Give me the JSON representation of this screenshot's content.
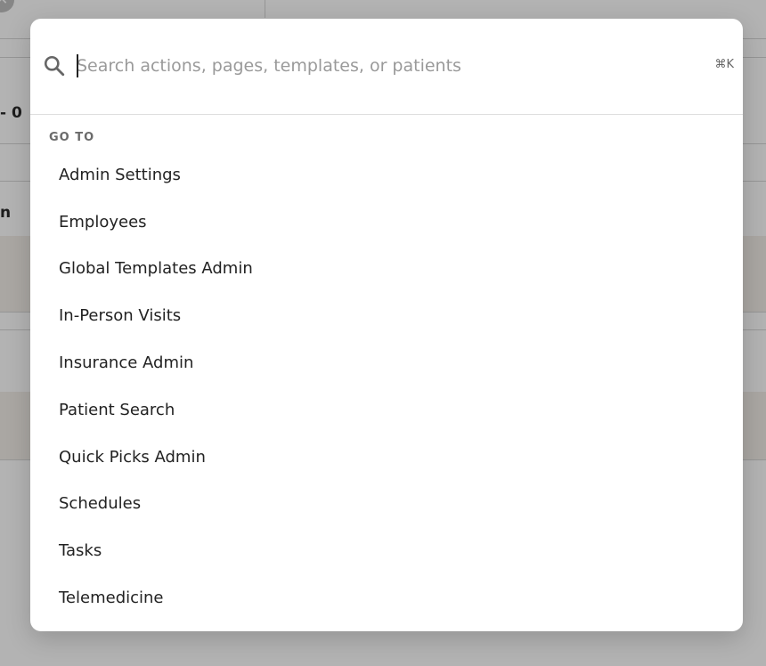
{
  "background": {
    "partial_texts": [
      "- 0",
      "n"
    ]
  },
  "palette": {
    "search": {
      "value": "",
      "placeholder": "Search actions, pages, templates, or patients",
      "shortcut": "⌘K"
    },
    "section_heading": "GO TO",
    "items": [
      {
        "label": "Admin Settings"
      },
      {
        "label": "Employees"
      },
      {
        "label": "Global Templates Admin"
      },
      {
        "label": "In-Person Visits"
      },
      {
        "label": "Insurance Admin"
      },
      {
        "label": "Patient Search"
      },
      {
        "label": "Quick Picks Admin"
      },
      {
        "label": "Schedules"
      },
      {
        "label": "Tasks"
      },
      {
        "label": "Telemedicine"
      }
    ]
  }
}
